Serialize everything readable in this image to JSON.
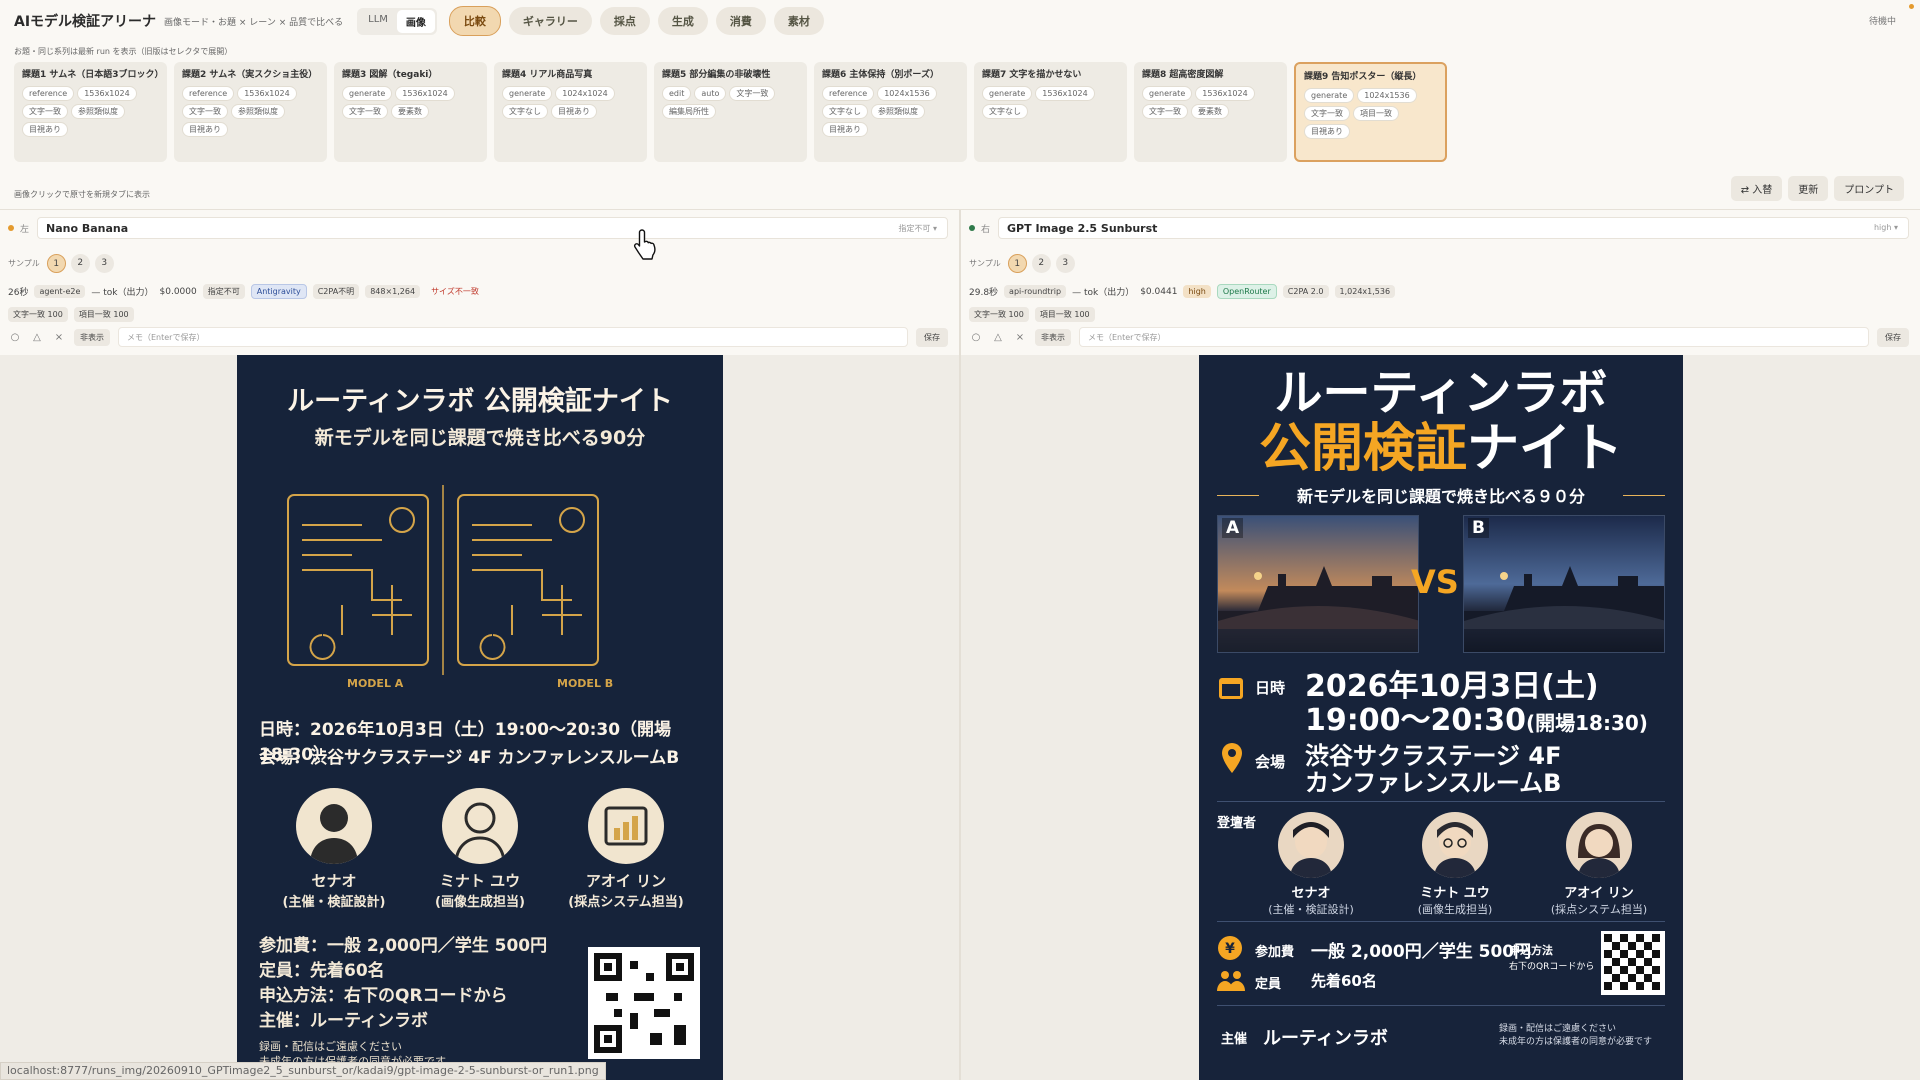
{
  "app": {
    "title": "AIモデル検証アリーナ",
    "subtitle": "画像モード・お題 × レーン × 品質で比べる",
    "status": "待機中"
  },
  "mode": {
    "llm": "LLM",
    "image": "画像"
  },
  "tabs": [
    "比較",
    "ギャラリー",
    "採点",
    "生成",
    "消費",
    "素材"
  ],
  "note": "お題・同じ系列は最新 run を表示（旧版はセレクタで展開）",
  "tasks": [
    {
      "title": "課題1 サムネ（日本語3ブロック）",
      "chips": [
        "reference",
        "1536x1024",
        "文字一致",
        "参照類似度",
        "目視あり"
      ]
    },
    {
      "title": "課題2 サムネ（実スクショ主役）",
      "chips": [
        "reference",
        "1536x1024",
        "文字一致",
        "参照類似度",
        "目視あり"
      ]
    },
    {
      "title": "課題3 図解（tegaki）",
      "chips": [
        "generate",
        "1536x1024",
        "文字一致",
        "要素数"
      ]
    },
    {
      "title": "課題4 リアル商品写真",
      "chips": [
        "generate",
        "1024x1024",
        "文字なし",
        "目視あり"
      ]
    },
    {
      "title": "課題5 部分編集の非破壊性",
      "chips": [
        "edit",
        "auto",
        "文字一致",
        "編集局所性"
      ]
    },
    {
      "title": "課題6 主体保持（別ポーズ）",
      "chips": [
        "reference",
        "1024x1536",
        "文字なし",
        "参照類似度",
        "目視あり"
      ]
    },
    {
      "title": "課題7 文字を描かせない",
      "chips": [
        "generate",
        "1536x1024",
        "文字なし"
      ]
    },
    {
      "title": "課題8 超高密度図解",
      "chips": [
        "generate",
        "1536x1024",
        "文字一致",
        "要素数"
      ]
    },
    {
      "title": "課題9 告知ポスター（縦長）",
      "chips": [
        "generate",
        "1024x1536",
        "文字一致",
        "項目一致",
        "目視あり"
      ]
    }
  ],
  "hint": "画像クリックで原寸を新規タブに表示",
  "actions": {
    "swap": "⇄ 入替",
    "refresh": "更新",
    "prompt": "プロンプト"
  },
  "colors": {
    "left_dot": "#e49a2e",
    "right_dot": "#2f7a4a"
  },
  "left": {
    "side": "左",
    "model": "Nano Banana",
    "option": "指定不可",
    "sample_label": "サンプル",
    "samples": [
      "1",
      "2",
      "3"
    ],
    "time": "26秒",
    "lane": "agent-e2e",
    "tok": "— tok（出力）",
    "cost": "$0.0000",
    "quality": "指定不可",
    "provider": "Antigravity",
    "c2pa": "C2PA不明",
    "size": "848×1,264",
    "warn": "サイズ不一致",
    "text_match": "文字一致 100",
    "item_match": "項目一致 100",
    "hide": "非表示",
    "memo": "メモ（Enterで保存）",
    "save": "保存"
  },
  "right": {
    "side": "右",
    "model": "GPT Image 2.5 Sunburst",
    "option": "high",
    "sample_label": "サンプル",
    "samples": [
      "1",
      "2",
      "3"
    ],
    "time": "29.8秒",
    "lane": "api-roundtrip",
    "tok": "— tok（出力）",
    "cost": "$0.0441",
    "quality": "high",
    "provider": "OpenRouter",
    "c2pa": "C2PA 2.0",
    "size": "1,024x1,536",
    "text_match": "文字一致 100",
    "item_match": "項目一致 100",
    "hide": "非表示",
    "memo": "メモ（Enterで保存）",
    "save": "保存"
  },
  "posterA": {
    "title": "ルーティンラボ 公開検証ナイト",
    "subtitle": "新モデルを同じ課題で焼き比べる90分",
    "model_a": "MODEL A",
    "model_b": "MODEL B",
    "date": "日時：2026年10月3日（土）19:00〜20:30（開場18:30）",
    "venue": "会場：渋谷サクラステージ 4F カンファレンスルームB",
    "speakers": [
      {
        "name": "セナオ",
        "role": "(主催・検証設計)"
      },
      {
        "name": "ミナト ユウ",
        "role": "(画像生成担当)"
      },
      {
        "name": "アオイ リン",
        "role": "(採点システム担当)"
      }
    ],
    "fee": "参加費：一般 2,000円／学生 500円",
    "capacity": "定員：先着60名",
    "apply": "申込方法：右下のQRコードから",
    "host": "主催：ルーティンラボ",
    "notice1": "録画・配信はご遠慮ください",
    "notice2": "未成年の方は保護者の同意が必要です"
  },
  "posterB": {
    "title1": "ルーティンラボ",
    "title2a": "公開検証",
    "title2b": "ナイト",
    "subtitle": "新モデルを同じ課題で焼き比べる９０分",
    "label_a": "A",
    "label_b": "B",
    "vs": "VS",
    "date_label": "日時",
    "date1": "2026年10月3日(土)",
    "date2": "19:00〜20:30",
    "date_open": "(開場18:30)",
    "venue_label": "会場",
    "venue1": "渋谷サクラステージ 4F",
    "venue2": "カンファレンスルームB",
    "speakers_label": "登壇者",
    "speakers": [
      {
        "name": "セナオ",
        "role": "(主催・検証設計)"
      },
      {
        "name": "ミナト ユウ",
        "role": "(画像生成担当)"
      },
      {
        "name": "アオイ リン",
        "role": "(採点システム担当)"
      }
    ],
    "fee_label": "参加費",
    "fee": "一般 2,000円／学生 500円",
    "cap_label": "定員",
    "cap": "先着60名",
    "apply_label": "申込方法",
    "apply": "右下のQRコードから",
    "host_label": "主催",
    "host": "ルーティンラボ",
    "notice1": "録画・配信はご遠慮ください",
    "notice2": "未成年の方は保護者の同意が必要です"
  },
  "status_url": "localhost:8777/runs_img/20260910_GPTimage2_5_sunburst_or/kadai9/gpt-image-2-5-sunburst-or_run1.png"
}
